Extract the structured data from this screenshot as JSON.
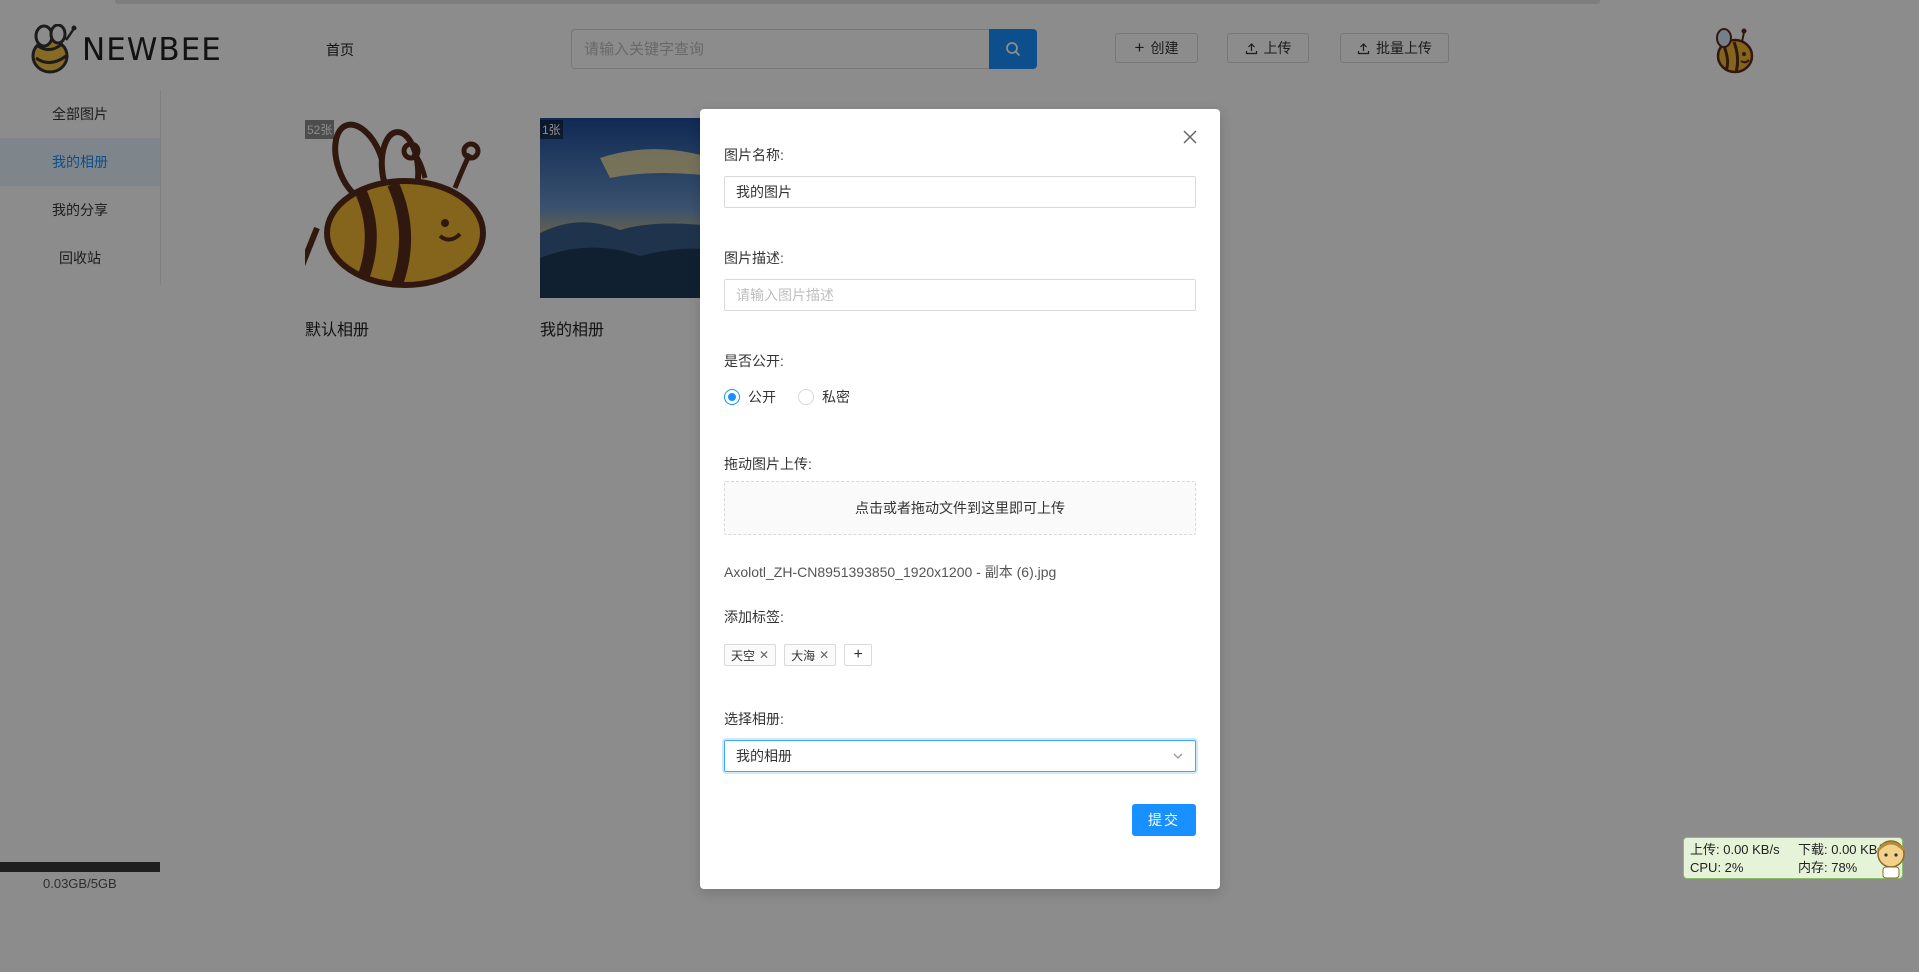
{
  "app": {
    "logo_text": "NEWBEE"
  },
  "header": {
    "nav_home": "首页",
    "search_placeholder": "请输入关键字查询",
    "create_label": "创建",
    "upload_label": "上传",
    "batch_upload_label": "批量上传"
  },
  "sidebar": {
    "items": [
      {
        "label": "全部图片",
        "active": false
      },
      {
        "label": "我的相册",
        "active": true
      },
      {
        "label": "我的分享",
        "active": false
      },
      {
        "label": "回收站",
        "active": false
      }
    ],
    "storage_text": "0.03GB/5GB",
    "storage_fraction": 0.006
  },
  "albums": [
    {
      "name": "默认相册",
      "count": "52张"
    },
    {
      "name": "我的相册",
      "count": "1张"
    }
  ],
  "modal": {
    "name_label": "图片名称:",
    "name_value": "我的图片",
    "desc_label": "图片描述:",
    "desc_placeholder": "请输入图片描述",
    "public_label": "是否公开:",
    "public_option": "公开",
    "private_option": "私密",
    "public_selected": true,
    "drag_label": "拖动图片上传:",
    "dropzone_text": "点击或者拖动文件到这里即可上传",
    "filename": "Axolotl_ZH-CN8951393850_1920x1200 - 副本 (6).jpg",
    "tags_label": "添加标签:",
    "tags": [
      "天空",
      "大海"
    ],
    "album_label": "选择相册:",
    "album_value": "我的相册",
    "submit_label": "提交"
  },
  "netmon": {
    "upload": "上传: 0.00 KB/s",
    "download": "下载: 0.00 KB/s",
    "cpu": "CPU: 2%",
    "memory": "内存: 78%"
  },
  "colors": {
    "primary": "#1890ff",
    "overlay": "rgba(0,0,0,0.45)"
  }
}
